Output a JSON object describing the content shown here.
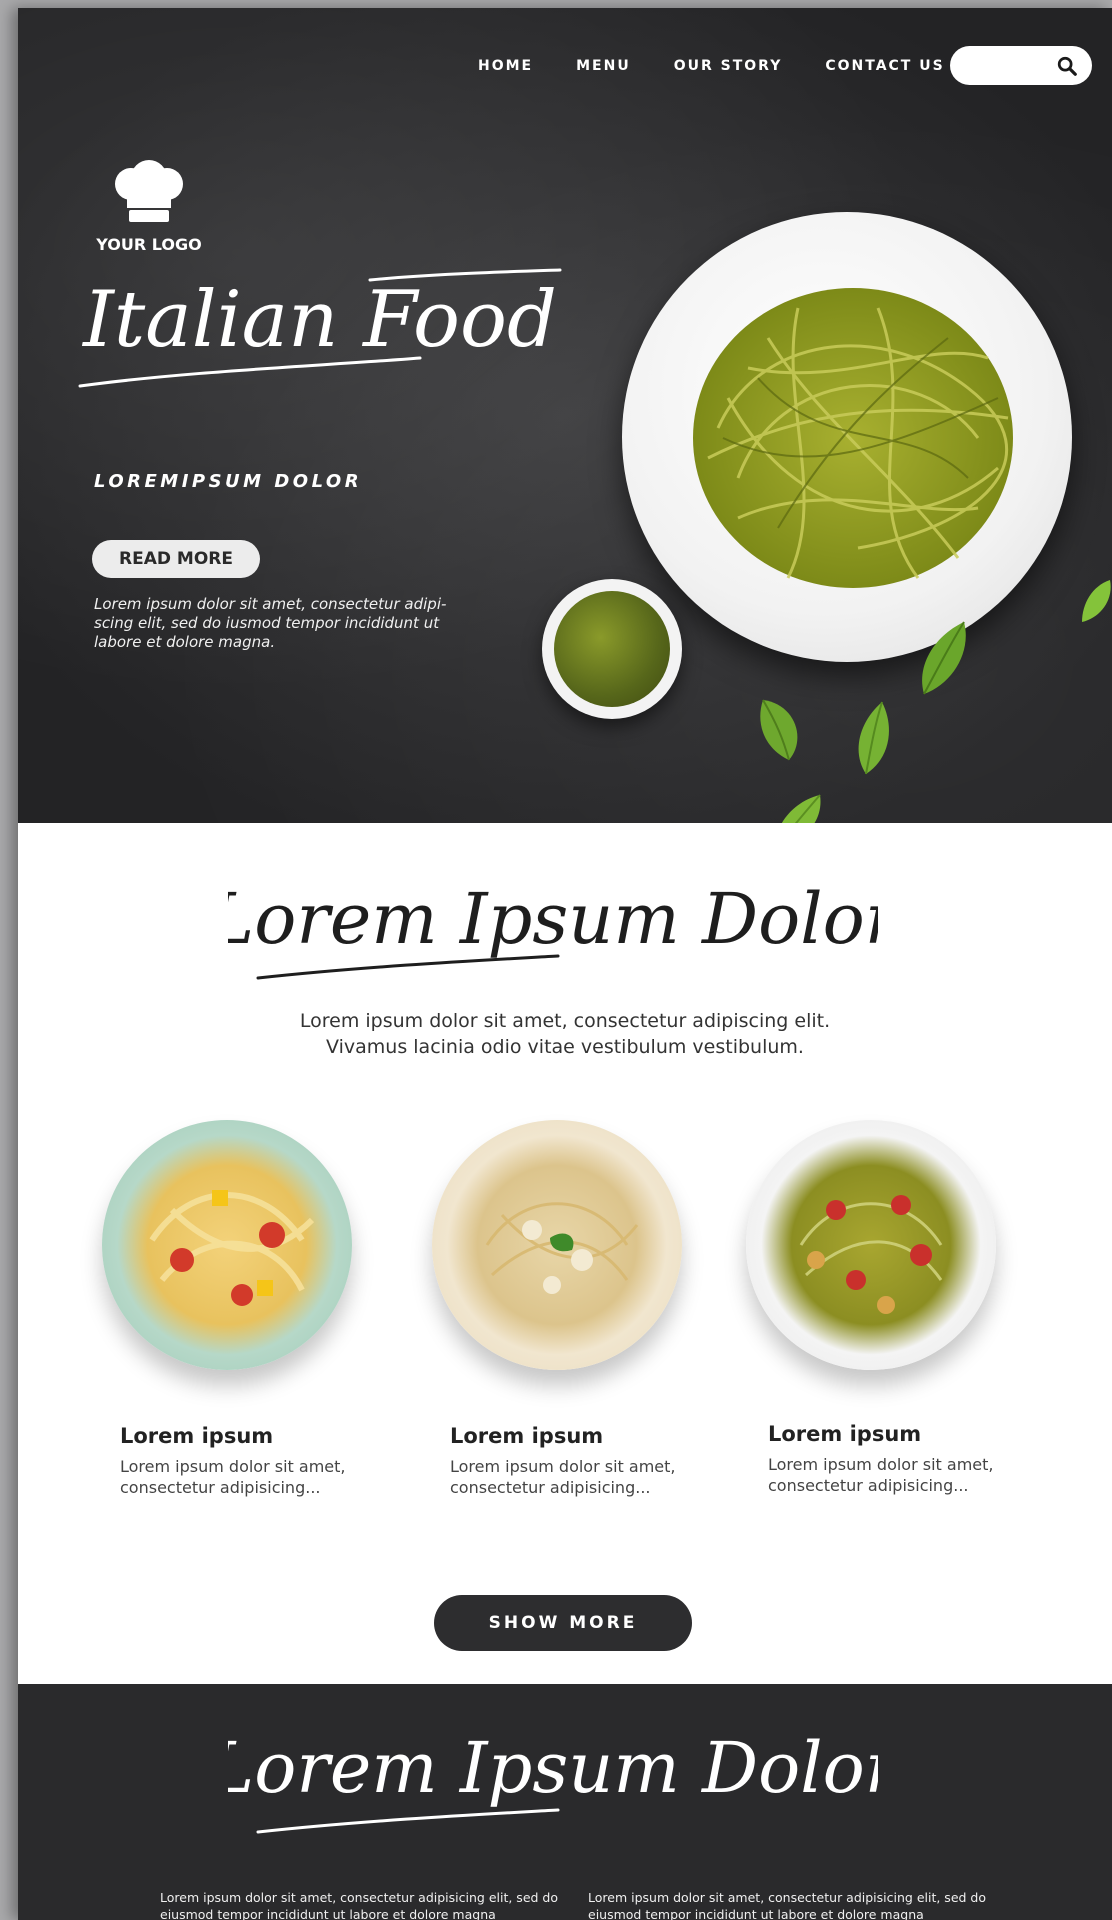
{
  "nav": {
    "items": [
      "HOME",
      "MENU",
      "OUR STORY",
      "CONTACT US"
    ],
    "search": {
      "placeholder": "",
      "icon": "search-icon"
    }
  },
  "hero": {
    "logo_text": "YOUR LOGO",
    "title": "Italian Food",
    "subtitle": "LOREMIPSUM DOLOR",
    "cta": "READ MORE",
    "description": "Lorem ipsum dolor sit amet, consectetur adipi-scing elit, sed do iusmod tempor incididunt ut labore et dolore magna."
  },
  "section": {
    "title": "Lorem Ipsum Dolor",
    "description_line1": "Lorem ipsum dolor sit amet, consectetur adipiscing elit.",
    "description_line2": "Vivamus lacinia odio vitae vestibulum vestibulum.",
    "dishes": [
      {
        "title": "Lorem ipsum",
        "text": "Lorem ipsum dolor sit amet, consectetur  adipisicing..."
      },
      {
        "title": "Lorem ipsum",
        "text": "Lorem ipsum dolor sit amet, consectetur  adipisicing..."
      },
      {
        "title": "Lorem ipsum",
        "text": "Lorem ipsum dolor sit amet, consectetur  adipisicing..."
      }
    ],
    "show_more": "SHOW MORE"
  },
  "footer": {
    "title": "Lorem Ipsum Dolor",
    "col1": "Lorem ipsum dolor sit amet, consectetur adipisicing elit, sed do eiusmod tempor incididunt ut labore et dolore magna",
    "col2": "Lorem ipsum dolor sit amet, consectetur adipisicing elit, sed do eiusmod tempor incididunt ut labore et dolore magna"
  },
  "colors": {
    "hero_bg": "#2e2e30",
    "footer_bg": "#2a2a2c",
    "button_dark": "#2d2d2f",
    "pesto_green": "#9aa62c"
  }
}
